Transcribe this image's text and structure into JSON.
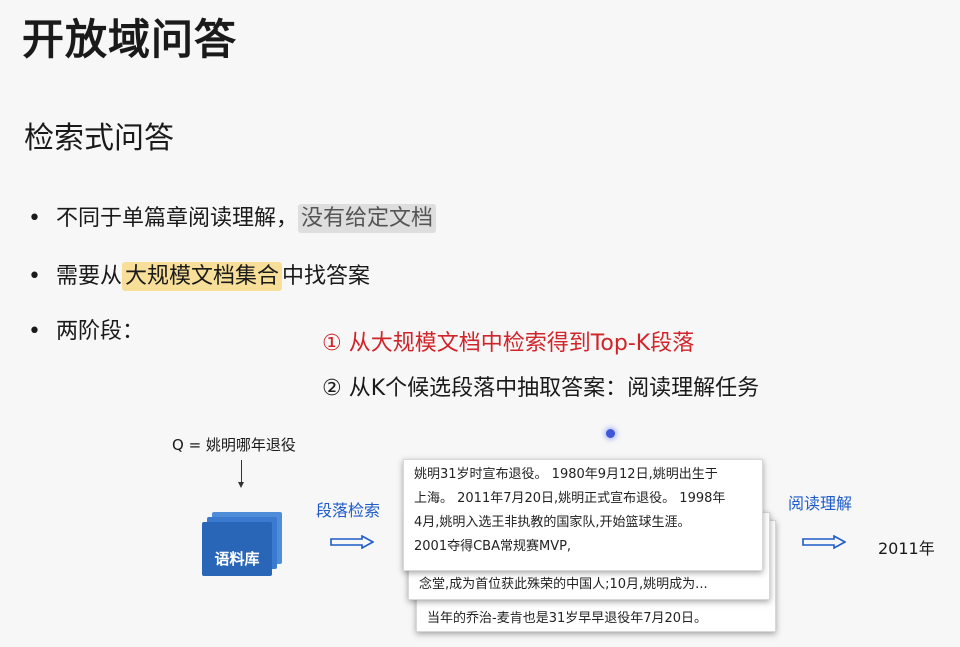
{
  "slide": {
    "title": "开放域问答",
    "subtitle": "检索式问答"
  },
  "bullets": [
    {
      "marker": "•",
      "pre": "不同于单篇章阅读理解，",
      "highlight": "没有给定文档",
      "post": ""
    },
    {
      "marker": "•",
      "pre": "需要从",
      "highlight": "大规模文档集合",
      "post": "中找答案"
    },
    {
      "marker": "•",
      "pre": "两阶段：",
      "highlight": "",
      "post": ""
    }
  ],
  "steps": [
    "① 从大规模文档中检索得到Top-K段落",
    "② 从K个候选段落中抽取答案：阅读理解任务"
  ],
  "diagram": {
    "query": "Q = 姚明哪年退役",
    "corpus_label": "语料库",
    "retrieval_label": "段落检索",
    "reading_label": "阅读理解",
    "answer": "2011年",
    "passages_front": [
      "姚明31岁时宣布退役。 1980年9月12日,姚明出生于",
      "上海。 2011年7月20日,姚明正式宣布退役。 1998年",
      "4月,姚明入选王非执教的国家队,开始篮球生涯。",
      "2001夺得CBA常规赛MVP,"
    ],
    "passage_middle": "念堂,成为首位获此殊荣的中国人;10月,姚明成为...",
    "passage_back": "当年的乔治-麦肯也是31岁早早退役年7月20日。"
  },
  "colors": {
    "step1": "#d1242a",
    "blue_label": "#1f5cc9",
    "corpus": "#2a66b8",
    "highlight_gray": "#dedede",
    "highlight_yellow": "#f7df9a"
  }
}
